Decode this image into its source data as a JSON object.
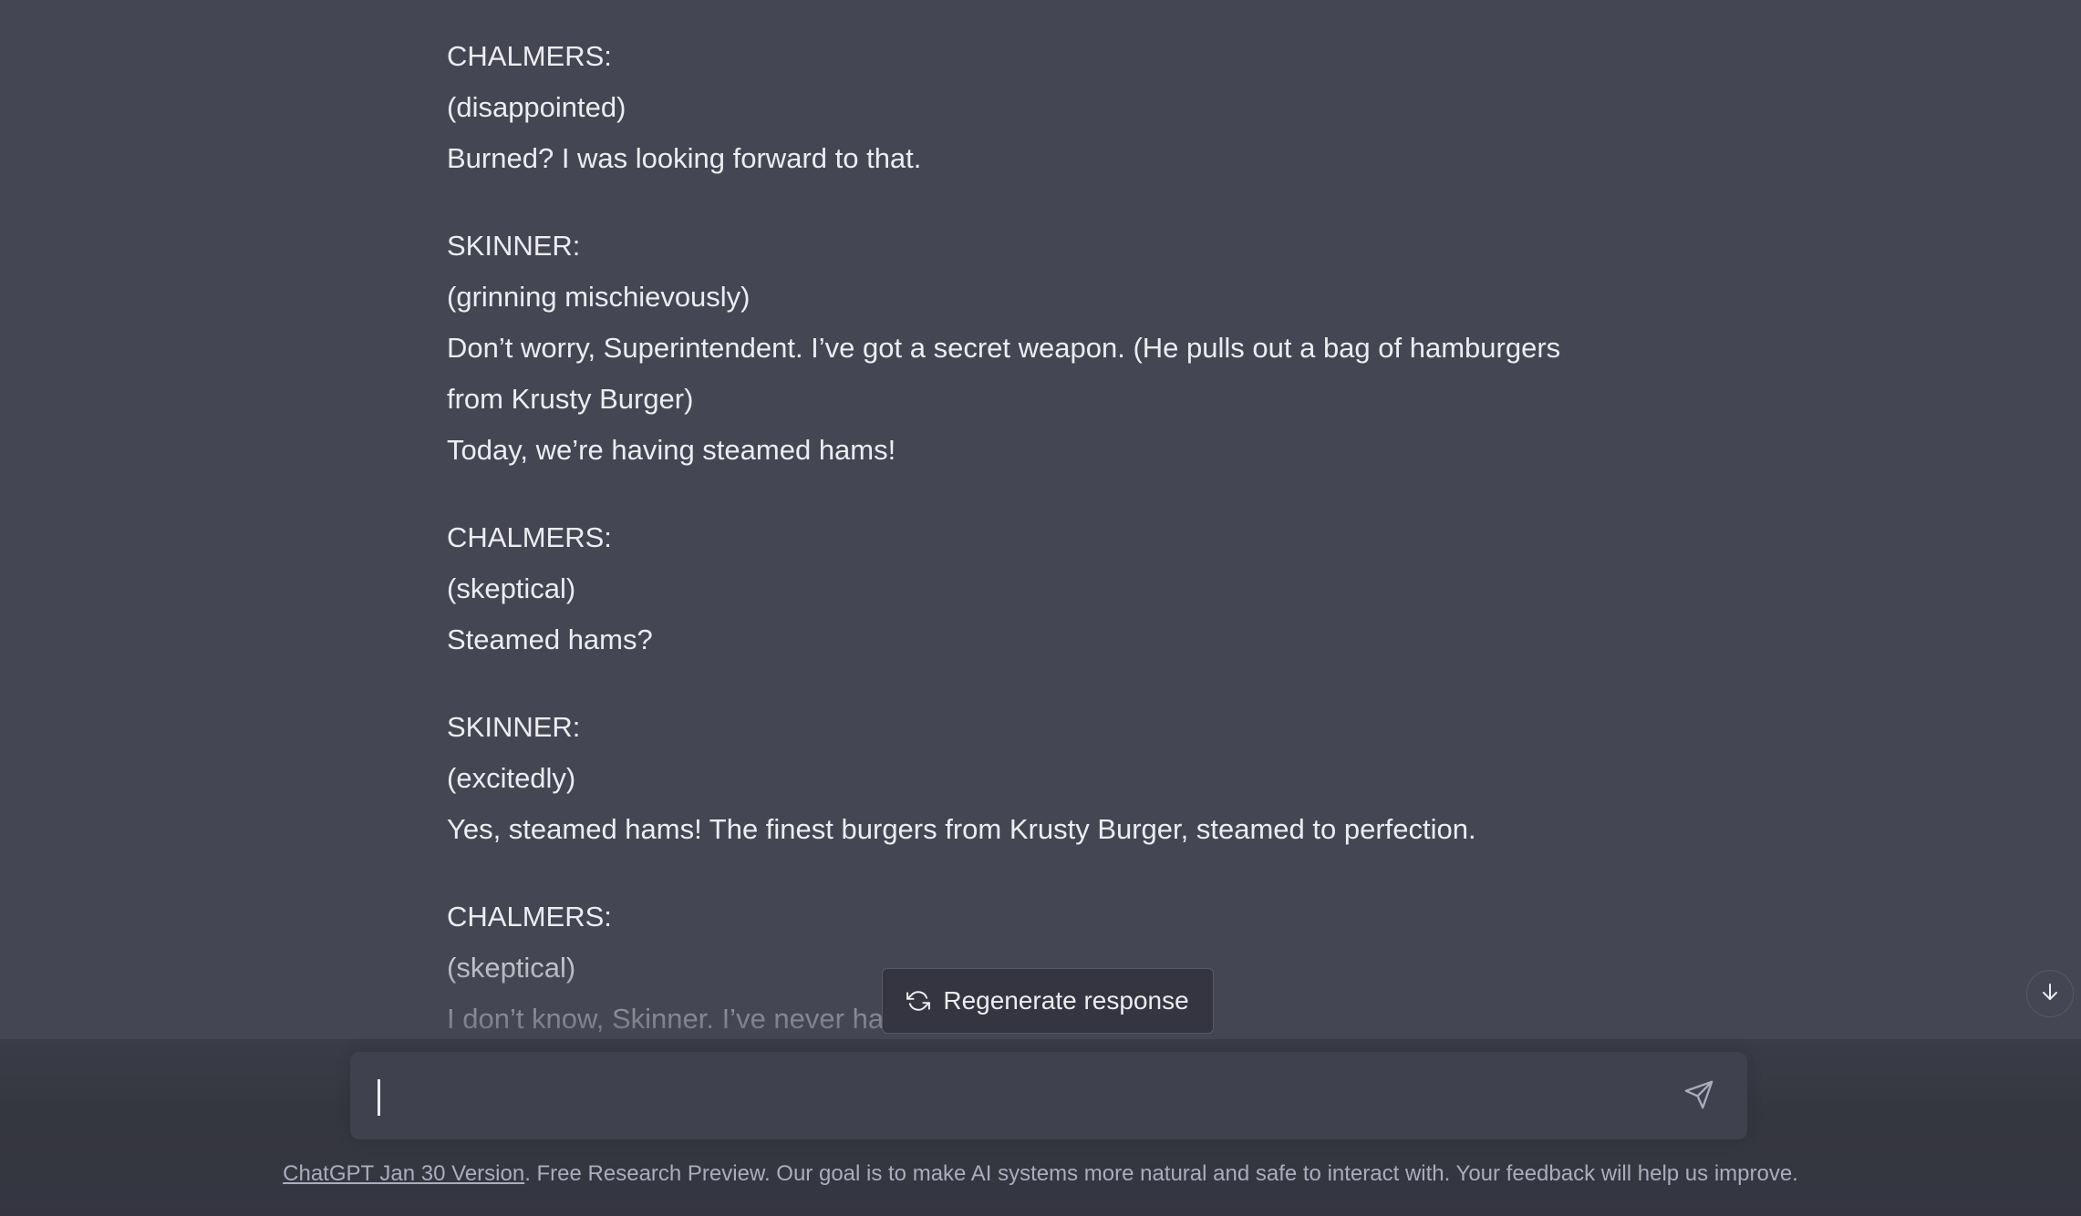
{
  "conversation": [
    {
      "lines": [
        "CHALMERS:",
        "(disappointed)",
        "Burned? I was looking forward to that."
      ]
    },
    {
      "lines": [
        "SKINNER:",
        "(grinning mischievously)",
        "Don’t worry, Superintendent. I’ve got a secret weapon. (He pulls out a bag of hamburgers",
        "from Krusty Burger)",
        "Today, we’re having steamed hams!"
      ]
    },
    {
      "lines": [
        "CHALMERS:",
        "(skeptical)",
        "Steamed hams?"
      ]
    },
    {
      "lines": [
        "SKINNER:",
        "(excitedly)",
        "Yes, steamed hams! The finest burgers from Krusty Burger, steamed to perfection."
      ]
    },
    {
      "lines": [
        "CHALMERS:",
        "(skeptical)",
        "I don’t know, Skinner. I’ve never had steamed hams before."
      ]
    }
  ],
  "regenerate": {
    "label": "Regenerate response",
    "icon": "refresh-icon"
  },
  "composer": {
    "value": "",
    "send_icon": "send-icon"
  },
  "scroll_button": {
    "icon": "arrow-down-icon"
  },
  "footer": {
    "link_text": "ChatGPT Jan 30 Version",
    "text": ". Free Research Preview. Our goal is to make AI systems more natural and safe to interact with. Your feedback will help us improve."
  },
  "colors": {
    "background": "#444654",
    "composer": "#40414f",
    "text": "#ececf1",
    "muted": "#acacbe"
  }
}
